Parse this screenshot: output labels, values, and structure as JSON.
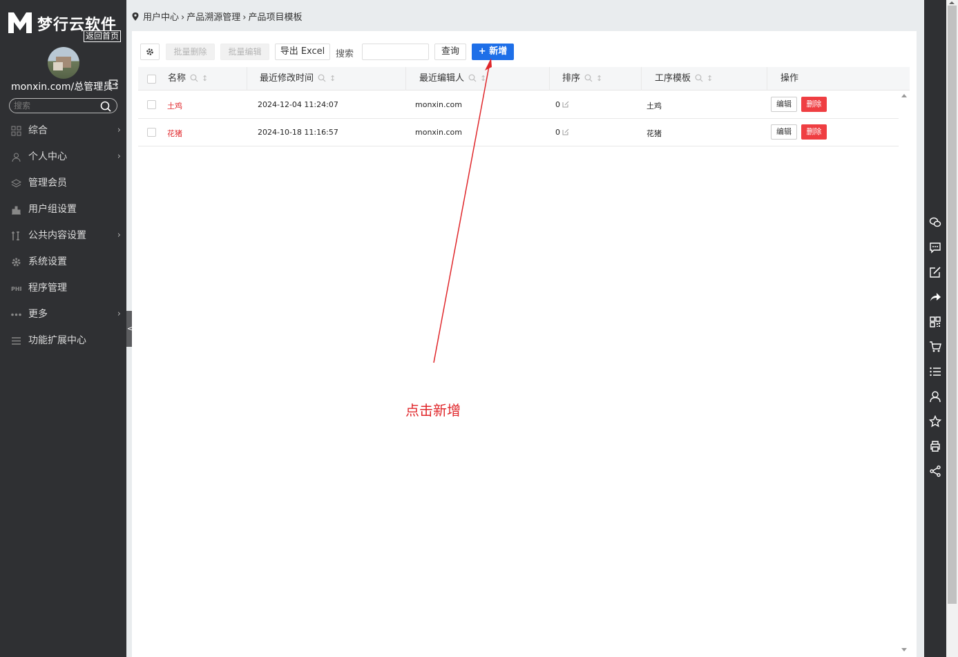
{
  "sidebar": {
    "logo_name": "梦行云软件",
    "home_link": "返回首页",
    "user": "monxin.com/总管理员",
    "search_placeholder": "搜索",
    "menu": [
      {
        "label": "综合",
        "icon": "grid-icon",
        "has_arrow": true
      },
      {
        "label": "个人中心",
        "icon": "user-icon",
        "has_arrow": true
      },
      {
        "label": "管理会员",
        "icon": "layers-icon",
        "has_arrow": false
      },
      {
        "label": "用户组设置",
        "icon": "group-icon",
        "has_arrow": false
      },
      {
        "label": "公共内容设置",
        "icon": "tools-icon",
        "has_arrow": true
      },
      {
        "label": "系统设置",
        "icon": "gear-icon",
        "has_arrow": false
      },
      {
        "label": "程序管理",
        "icon": "php-icon",
        "has_arrow": false
      },
      {
        "label": "更多",
        "icon": "more-icon",
        "has_arrow": true
      },
      {
        "label": "功能扩展中心",
        "icon": "list-icon",
        "has_arrow": false
      }
    ],
    "collapse_glyph": "<"
  },
  "breadcrumb": [
    "用户中心",
    "产品溯源管理",
    "产品项目模板"
  ],
  "toolbar": {
    "batch_delete": "批量删除",
    "batch_edit": "批量编辑",
    "export_excel": "导出 Excel",
    "search_label": "搜索",
    "query": "查询",
    "add": "+ 新增"
  },
  "table": {
    "columns": [
      "名称",
      "最近修改时间",
      "最近编辑人",
      "排序",
      "工序模板",
      "操作"
    ],
    "rows": [
      {
        "name": "土鸡",
        "modified": "2024-12-04 11:24:07",
        "editor": "monxin.com",
        "sort": "0",
        "template": "土鸡",
        "edit": "编辑",
        "delete": "删除"
      },
      {
        "name": "花猪",
        "modified": "2024-10-18 11:16:57",
        "editor": "monxin.com",
        "sort": "0",
        "template": "花猪",
        "edit": "编辑",
        "delete": "删除"
      }
    ]
  },
  "annotation": {
    "text": "点击新增",
    "color": "#e0262a"
  },
  "colors": {
    "sidebar_bg": "#2f3033",
    "primary": "#1e6fe8",
    "danger": "#ef3e42",
    "name_link": "#e0262a"
  },
  "right_toolbar": [
    "wechat-icon",
    "message-icon",
    "edit-icon",
    "share-arrow-icon",
    "qrcode-icon",
    "cart-icon",
    "list-icon",
    "user-icon",
    "star-icon",
    "print-icon",
    "share-icon"
  ]
}
